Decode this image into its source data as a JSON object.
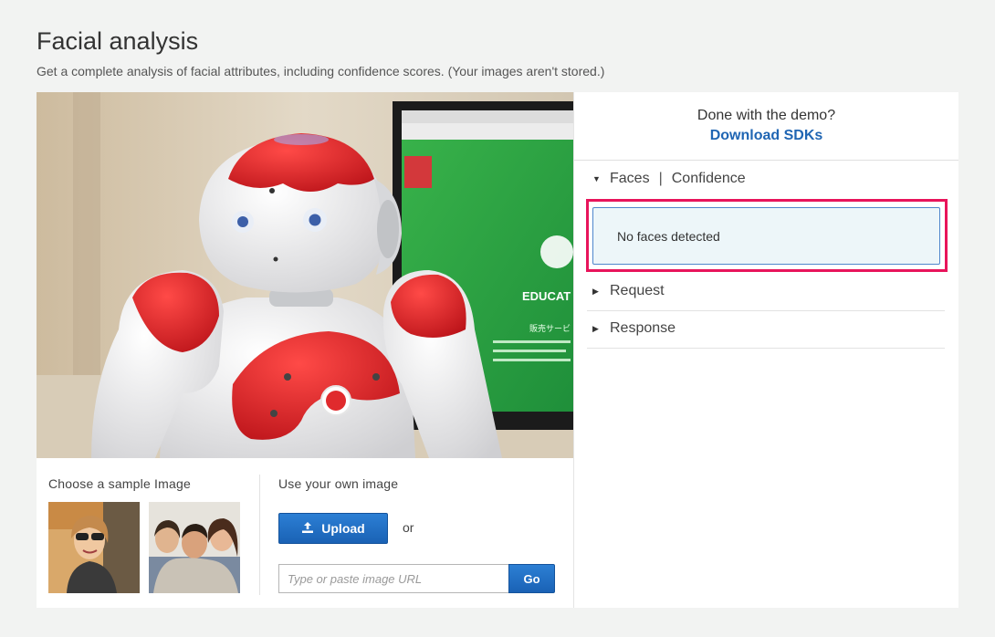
{
  "header": {
    "title": "Facial analysis",
    "subtitle": "Get a complete analysis of facial attributes, including confidence scores. (Your images aren't stored.)"
  },
  "preview_image": {
    "screen_texts": [
      "EDUCAT",
      "販売サービ"
    ]
  },
  "samples": {
    "label": "Choose a sample Image",
    "items": [
      {
        "name": "sample-woman-sunglasses-car"
      },
      {
        "name": "sample-family-selfie"
      }
    ]
  },
  "own_image": {
    "label": "Use your own image",
    "upload_label": "Upload",
    "or_label": "or",
    "url_value": "",
    "url_placeholder": "Type or paste image URL",
    "go_label": "Go"
  },
  "demo": {
    "question": "Done with the demo?",
    "download_label": "Download SDKs"
  },
  "results": {
    "faces_heading": "Faces",
    "separator": "|",
    "confidence_heading": "Confidence",
    "faces_message": "No faces detected",
    "request_heading": "Request",
    "response_heading": "Response"
  },
  "colors": {
    "accent_blue": "#1f65b3",
    "highlight": "#e8145b",
    "result_bg": "#edf6f9"
  },
  "icons": [
    "upload-icon",
    "triangle-down-icon",
    "triangle-right-icon"
  ]
}
